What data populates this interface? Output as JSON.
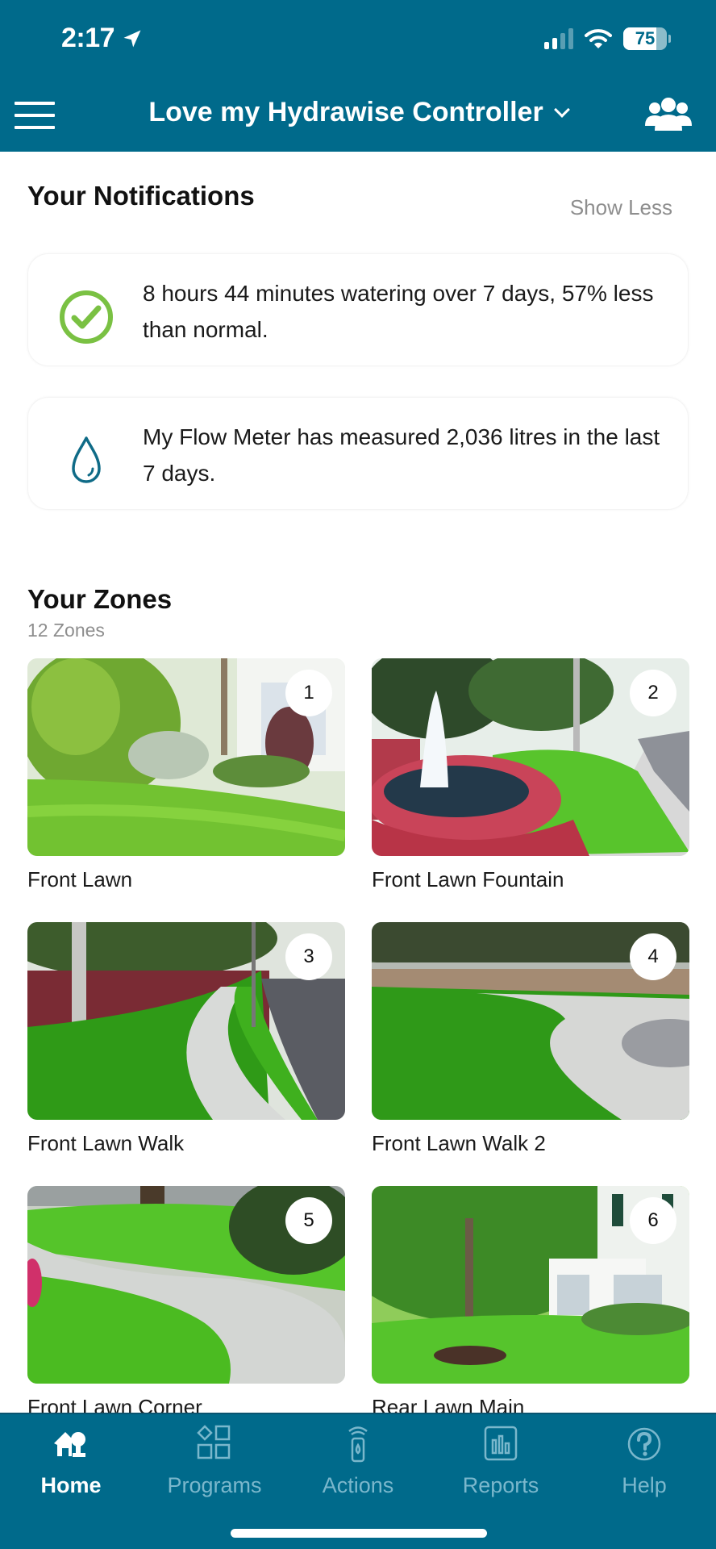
{
  "status_bar": {
    "time": "2:17",
    "battery_percent": "75",
    "battery_level": 0.75,
    "signal_bars_active": 2,
    "signal_bars_total": 4,
    "icons": [
      "location-arrow-icon",
      "signal-icon",
      "wifi-icon",
      "battery-icon"
    ]
  },
  "header": {
    "menu_icon": "hamburger-menu-icon",
    "title": "Love my Hydrawise Controller",
    "dropdown_icon": "chevron-down-icon",
    "users_icon": "users-group-icon"
  },
  "notifications": {
    "title": "Your Notifications",
    "toggle_label": "Show Less",
    "items": [
      {
        "icon": "check-circle-icon",
        "icon_color": "#7ac143",
        "text": "8 hours 44 minutes watering over 7 days, 57% less than normal."
      },
      {
        "icon": "water-drop-icon",
        "icon_color": "#0f6b87",
        "text": "My Flow Meter has measured 2,036 litres in the last 7 days."
      }
    ]
  },
  "zones": {
    "title": "Your Zones",
    "count_label": "12 Zones",
    "items": [
      {
        "number": "1",
        "name": "Front Lawn"
      },
      {
        "number": "2",
        "name": "Front Lawn Fountain"
      },
      {
        "number": "3",
        "name": "Front Lawn Walk"
      },
      {
        "number": "4",
        "name": "Front Lawn Walk 2"
      },
      {
        "number": "5",
        "name": "Front Lawn Corner"
      },
      {
        "number": "6",
        "name": "Rear Lawn Main"
      }
    ]
  },
  "tabbar": {
    "active": "Home",
    "tabs": [
      {
        "label": "Home",
        "icon": "home-tree-icon"
      },
      {
        "label": "Programs",
        "icon": "programs-grid-icon"
      },
      {
        "label": "Actions",
        "icon": "remote-control-icon"
      },
      {
        "label": "Reports",
        "icon": "bar-chart-icon"
      },
      {
        "label": "Help",
        "icon": "help-circle-icon"
      }
    ]
  },
  "colors": {
    "brand": "#006a8b",
    "tab_inactive": "#7ab7cc",
    "success": "#7ac143",
    "muted_text": "#8e8e8e"
  }
}
